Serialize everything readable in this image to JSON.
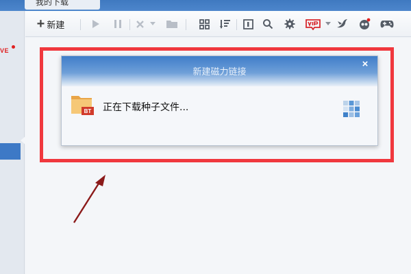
{
  "window": {
    "tab_label": "我的下载"
  },
  "sidebar": {
    "live_badge": "VE",
    "active_index": 4
  },
  "toolbar": {
    "new_label": "新建",
    "icons": [
      "play-icon",
      "pause-icon",
      "delete-icon",
      "dropdown-icon",
      "folder-icon",
      "grid-icon",
      "sort-icon",
      "single-view-icon",
      "search-icon",
      "settings-icon",
      "vip-icon",
      "bird-icon",
      "mascot-icon",
      "gamepad-icon"
    ]
  },
  "dialog": {
    "title": "新建磁力链接",
    "close_symbol": "×",
    "status": "正在下载种子文件...",
    "file_badge": "BT"
  },
  "colors": {
    "highlight": "#f0383e",
    "accent": "#3d79c6",
    "arrow": "#8b1a1a"
  }
}
